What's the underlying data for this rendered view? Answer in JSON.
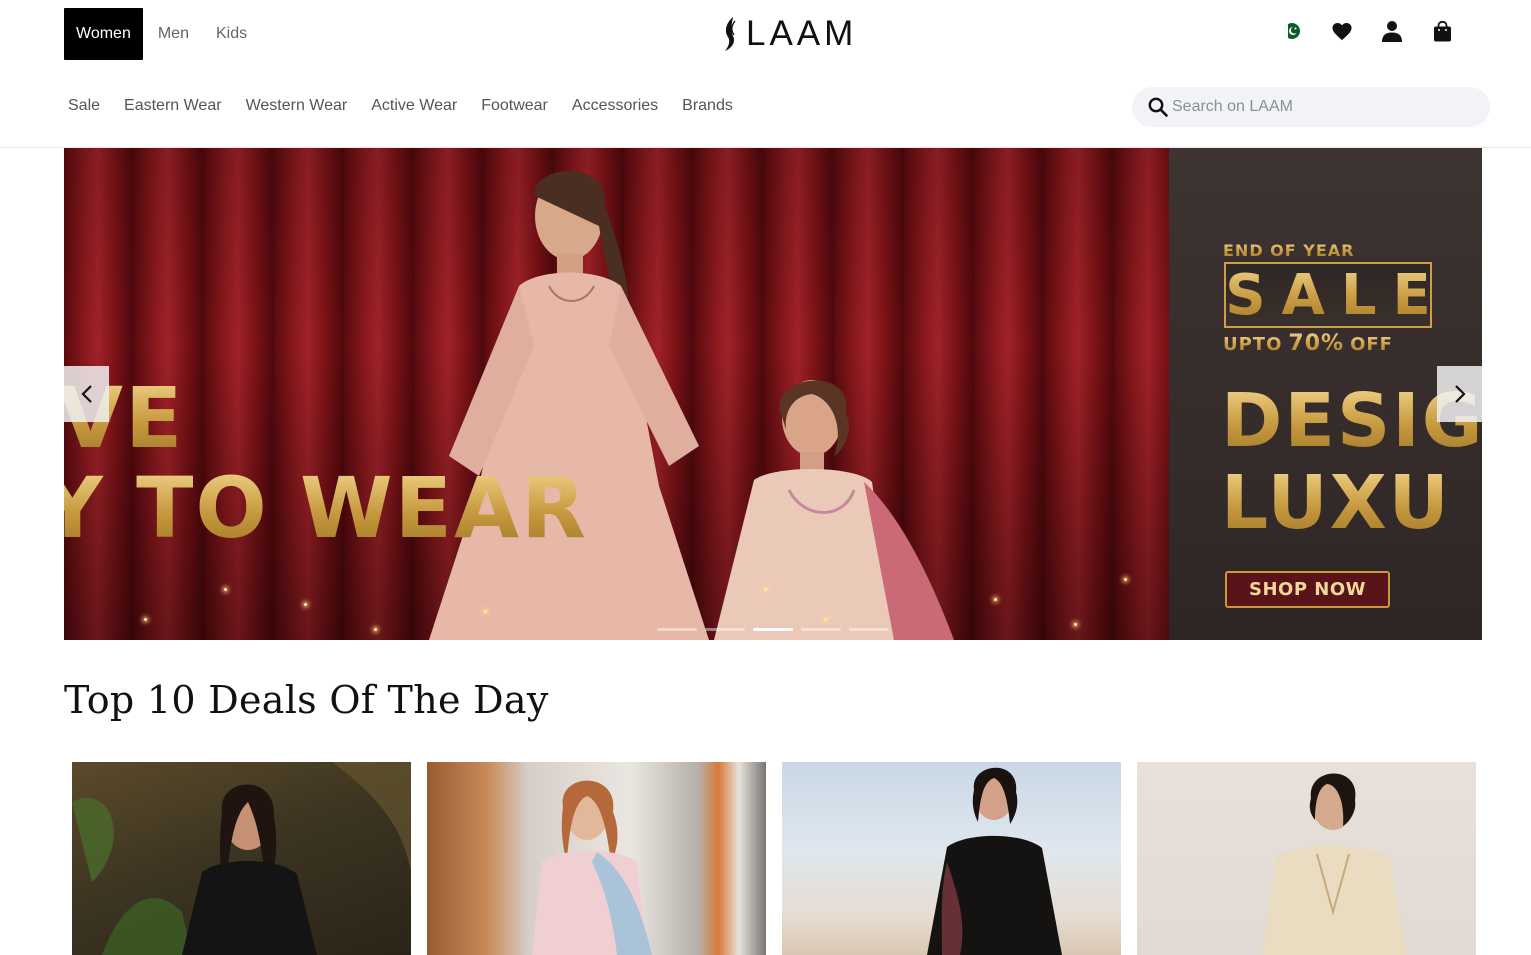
{
  "header": {
    "gender_tabs": [
      {
        "label": "Women",
        "active": true
      },
      {
        "label": "Men",
        "active": false
      },
      {
        "label": "Kids",
        "active": false
      }
    ],
    "logo_text": "LAAM",
    "icons": [
      "pakistan-flag-icon",
      "heart-icon",
      "user-icon",
      "shopping-bag-icon"
    ]
  },
  "nav": {
    "items": [
      "Sale",
      "Eastern Wear",
      "Western Wear",
      "Active Wear",
      "Footwear",
      "Accessories",
      "Brands"
    ]
  },
  "search": {
    "placeholder": "Search on LAAM",
    "value": ""
  },
  "hero": {
    "left_line1": "VE",
    "left_line2": "Y TO WEAR",
    "promo_small": "END OF YEAR",
    "promo_sale": "SALE",
    "promo_upto": "UPTO",
    "promo_percent": "70%",
    "promo_off": "OFF",
    "promo_line1": "DESIG",
    "promo_line2": "LUXU",
    "cta": "SHOP NOW",
    "slides_total": 5,
    "active_slide": 3,
    "colors": {
      "gold": "#c9a24c",
      "curtain": "#8d1a1f",
      "panel": "#3a302c"
    }
  },
  "deals": {
    "title": "Top 10 Deals Of The Day",
    "cards": [
      {
        "name": "deal-card-1"
      },
      {
        "name": "deal-card-2"
      },
      {
        "name": "deal-card-3"
      },
      {
        "name": "deal-card-4"
      }
    ]
  }
}
